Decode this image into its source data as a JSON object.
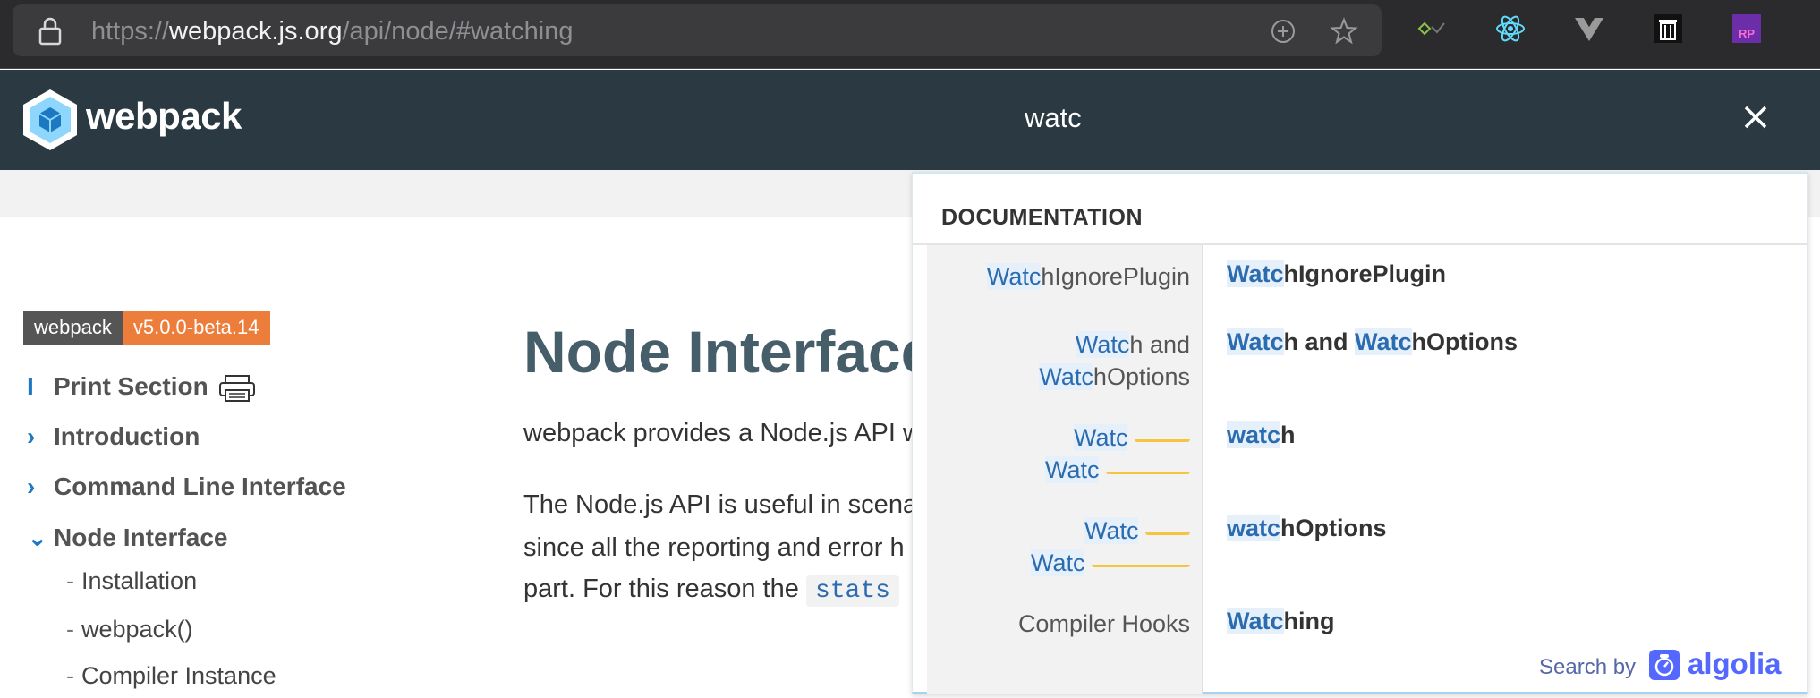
{
  "browser": {
    "url_scheme": "https://",
    "url_host": "webpack.js.org",
    "url_path": "/api/node/#watching",
    "extensions": [
      "graphql-icon",
      "react-icon",
      "vue-icon",
      "trash-icon",
      "rp-icon"
    ]
  },
  "site": {
    "logo_text": "webpack",
    "search_query": "watc"
  },
  "sidebar": {
    "version_name": "webpack",
    "version_number": "v5.0.0-beta.14",
    "items": [
      {
        "marker": "I",
        "label": "Print Section"
      },
      {
        "marker": "›",
        "label": "Introduction"
      },
      {
        "marker": "›",
        "label": "Command Line Interface"
      },
      {
        "marker": "⌄",
        "label": "Node Interface"
      }
    ],
    "sub_items": [
      "Installation",
      "webpack()",
      "Compiler Instance"
    ]
  },
  "main": {
    "title": "Node Interface",
    "para1": "webpack provides a Node.js API w",
    "para2_line1": "The Node.js API is useful in scena",
    "para2_line2": "since all the reporting and error h",
    "para2_line3": "part. For this reason the",
    "code": "stats"
  },
  "search_results": {
    "header": "DOCUMENTATION",
    "rows": [
      {
        "left_hl": "Watc",
        "left_rest": "hIgnorePlugin",
        "right_hl": "Watc",
        "right_rest": "hIgnorePlugin"
      },
      {
        "left_hl": "Watc",
        "left_rest": "h and",
        "left_hl2": "Watc",
        "left_rest2": "hOptions",
        "right_hl": "Watc",
        "right_rest": "h and ",
        "right_hl2": "Watc",
        "right_rest2": "hOptions"
      },
      {
        "left_hl": "Watc",
        "left_hl2": "Watc",
        "right_hl": "watc",
        "right_rest": "h"
      },
      {
        "left_hl": "Watc",
        "left_hl2": "Watc",
        "right_hl": "watc",
        "right_rest": "hOptions"
      },
      {
        "left_rest": "Compiler Hooks",
        "right_hl": "Watc",
        "right_rest": "hing"
      }
    ],
    "search_by": "Search by",
    "provider": "algolia"
  }
}
